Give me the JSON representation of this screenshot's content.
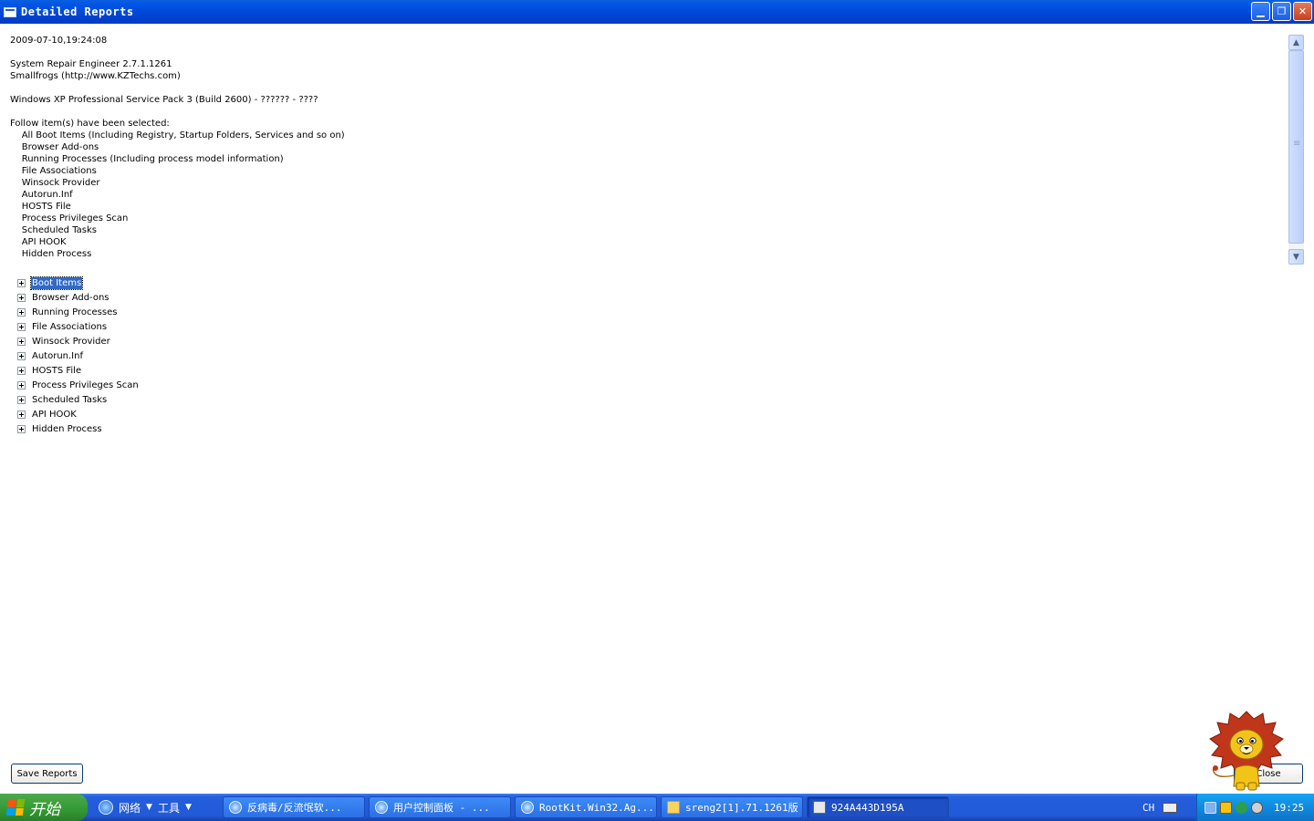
{
  "window": {
    "title": "Detailed Reports",
    "minimize_icon": "minimize-icon",
    "restore_icon": "restore-icon",
    "close_icon": "close-icon"
  },
  "report": {
    "lines": [
      "2009-07-10,19:24:08",
      "",
      "System Repair Engineer 2.7.1.1261",
      "Smallfrogs (http://www.KZTechs.com)",
      "",
      "Windows XP Professional Service Pack 3 (Build 2600) - ?????? - ????",
      "",
      "Follow item(s) have been selected:",
      "    All Boot Items (Including Registry, Startup Folders, Services and so on)",
      "    Browser Add-ons",
      "    Running Processes (Including process model information)",
      "    File Associations",
      "    Winsock Provider",
      "    Autorun.Inf",
      "    HOSTS File",
      "    Process Privileges Scan",
      "    Scheduled Tasks",
      "    API HOOK",
      "    Hidden Process"
    ]
  },
  "tree": {
    "items": [
      "Boot Items",
      "Browser Add-ons",
      "Running Processes",
      "File Associations",
      "Winsock Provider",
      "Autorun.Inf",
      "HOSTS File",
      "Process Privileges Scan",
      "Scheduled Tasks",
      "API HOOK",
      "Hidden Process"
    ],
    "selected": "Boot Items"
  },
  "buttons": {
    "save": "Save Reports",
    "close": "Close"
  },
  "taskbar": {
    "start": "开始",
    "quick_items": [
      "网络",
      "工具"
    ],
    "tasks": [
      "反病毒/反流氓软...",
      "用户控制面板 - ...",
      "RootKit.Win32.Ag...",
      "sreng2[1].71.1261版",
      "924A443D195A"
    ],
    "lang": "CH",
    "time": "19:25"
  },
  "colors": {
    "titlebar": "#0055e5",
    "taskbar": "#245edc",
    "start": "#339933",
    "selection": "#316ac5",
    "tray": "#0f85dc"
  }
}
